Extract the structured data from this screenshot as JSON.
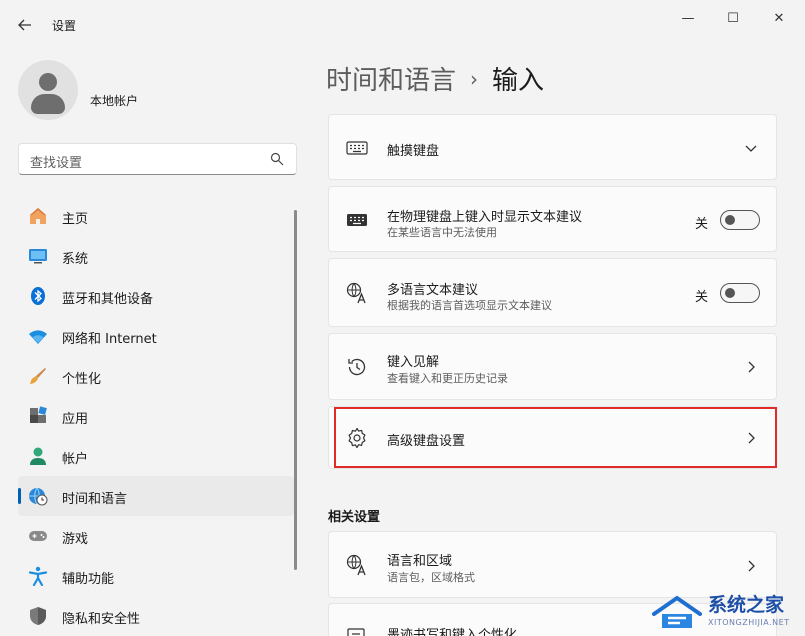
{
  "window": {
    "title": "设置",
    "controls": {
      "minimize": "—",
      "maximize": "☐",
      "close": "✕"
    }
  },
  "account": {
    "name": "本地帐户"
  },
  "search": {
    "placeholder": "查找设置"
  },
  "nav": {
    "items": [
      {
        "label": "主页",
        "icon": "home-icon"
      },
      {
        "label": "系统",
        "icon": "monitor-icon"
      },
      {
        "label": "蓝牙和其他设备",
        "icon": "bluetooth-icon"
      },
      {
        "label": "网络和 Internet",
        "icon": "wifi-icon"
      },
      {
        "label": "个性化",
        "icon": "brush-icon"
      },
      {
        "label": "应用",
        "icon": "apps-icon"
      },
      {
        "label": "帐户",
        "icon": "person-icon"
      },
      {
        "label": "时间和语言",
        "icon": "globe-clock-icon",
        "active": true
      },
      {
        "label": "游戏",
        "icon": "gamepad-icon"
      },
      {
        "label": "辅助功能",
        "icon": "accessibility-icon"
      },
      {
        "label": "隐私和安全性",
        "icon": "shield-icon"
      }
    ]
  },
  "breadcrumb": {
    "parent": "时间和语言",
    "separator": "›",
    "current": "输入"
  },
  "cards": {
    "touch_keyboard": {
      "title": "触摸键盘"
    },
    "text_suggestions": {
      "title": "在物理键盘上键入时显示文本建议",
      "subtitle": "在某些语言中无法使用",
      "toggle_label": "关"
    },
    "multilingual": {
      "title": "多语言文本建议",
      "subtitle": "根据我的语言首选项显示文本建议",
      "toggle_label": "关"
    },
    "typing_insights": {
      "title": "键入见解",
      "subtitle": "查看键入和更正历史记录"
    },
    "advanced_keyboard": {
      "title": "高级键盘设置"
    }
  },
  "related": {
    "title": "相关设置",
    "language_region": {
      "title": "语言和区域",
      "subtitle": "语言包，区域格式"
    },
    "pen_typing": {
      "title": "墨迹书写和键入个性化"
    }
  },
  "watermark": {
    "text": "系统之家",
    "sub": "XITONGZHIJIA.NET"
  },
  "colors": {
    "accent": "#005fb8",
    "highlight": "#e02b2b"
  }
}
